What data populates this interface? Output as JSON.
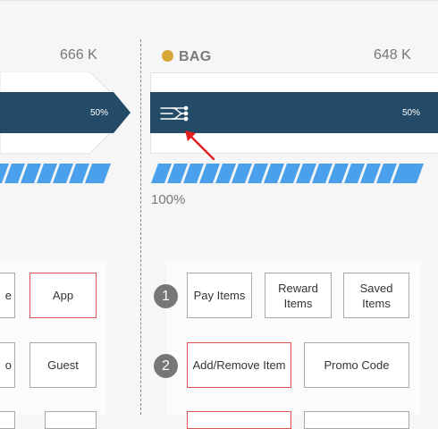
{
  "left_column": {
    "value": "666 K",
    "progress_label": "50%",
    "progress_fraction": 0.5,
    "buttons": [
      {
        "label": "e",
        "highlighted": false
      },
      {
        "label": "App",
        "highlighted": true
      },
      {
        "label": "o",
        "highlighted": false
      },
      {
        "label": "Guest",
        "highlighted": false
      }
    ]
  },
  "bag_column": {
    "title": "BAG",
    "dot_color": "#d9a738",
    "value": "648 K",
    "progress_label": "50%",
    "progress_fraction": 0.5,
    "icon": "flow-lines-icon",
    "completion_label": "100%",
    "rows": [
      {
        "step": "1",
        "buttons": [
          {
            "label": "Pay Items",
            "highlighted": false
          },
          {
            "label": "Reward Items",
            "highlighted": false
          },
          {
            "label": "Saved Items",
            "highlighted": false
          }
        ]
      },
      {
        "step": "2",
        "buttons": [
          {
            "label": "Add/Remove Item",
            "highlighted": true
          },
          {
            "label": "Promo Code",
            "highlighted": false
          }
        ]
      }
    ]
  },
  "colors": {
    "bar": "#234a66",
    "stripe": "#4aa0ea",
    "highlight_border": "#e05252",
    "arrow": "#e02020"
  }
}
